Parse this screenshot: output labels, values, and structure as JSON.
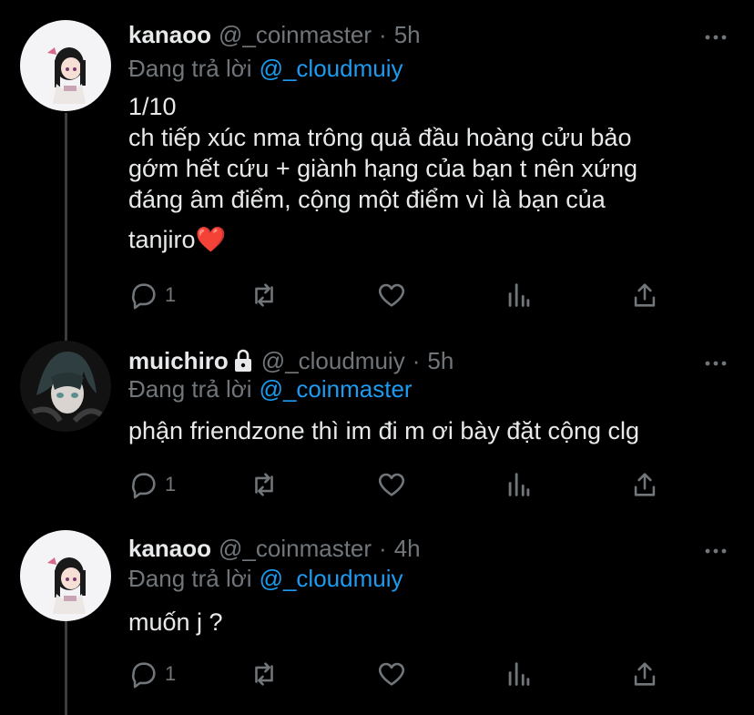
{
  "tweets": [
    {
      "name": "kanaoo",
      "handle": "@_coinmaster",
      "dot": "·",
      "time": "5h",
      "reply_prefix": "Đang trả lời",
      "reply_to": "@_cloudmuiy",
      "lines": [
        "1/10",
        "ch tiếp xúc nma trông quả đầu hoàng cửu bảo",
        "gớm hết cứu + giành hạng của bạn t nên xứng",
        "đáng âm điểm, cộng một điểm vì là bạn của",
        "tanjiro❤️"
      ],
      "reply_count": "1",
      "avatar": "kanao-avatar"
    },
    {
      "name": "muichiro",
      "locked": true,
      "handle": "@_cloudmuiy",
      "dot": "·",
      "time": "5h",
      "reply_prefix": "Đang trả lời",
      "reply_to": "@_coinmaster",
      "lines": [
        "phận friendzone thì im đi m ơi bày đặt cộng clg"
      ],
      "reply_count": "1",
      "avatar": "muichiro-avatar"
    },
    {
      "name": "kanaoo",
      "handle": "@_coinmaster",
      "dot": "·",
      "time": "4h",
      "reply_prefix": "Đang trả lời",
      "reply_to": "@_cloudmuiy",
      "lines": [
        "muốn j ?"
      ],
      "reply_count": "1",
      "avatar": "kanao-avatar"
    }
  ],
  "colors": {
    "background": "#000000",
    "text": "#e7e9ea",
    "muted": "#71767b",
    "link": "#1d9bf0",
    "thread_line": "#3a3c40"
  },
  "icons": [
    "reply-icon",
    "retweet-icon",
    "like-icon",
    "analytics-icon",
    "share-icon",
    "more-icon",
    "lock-icon"
  ]
}
